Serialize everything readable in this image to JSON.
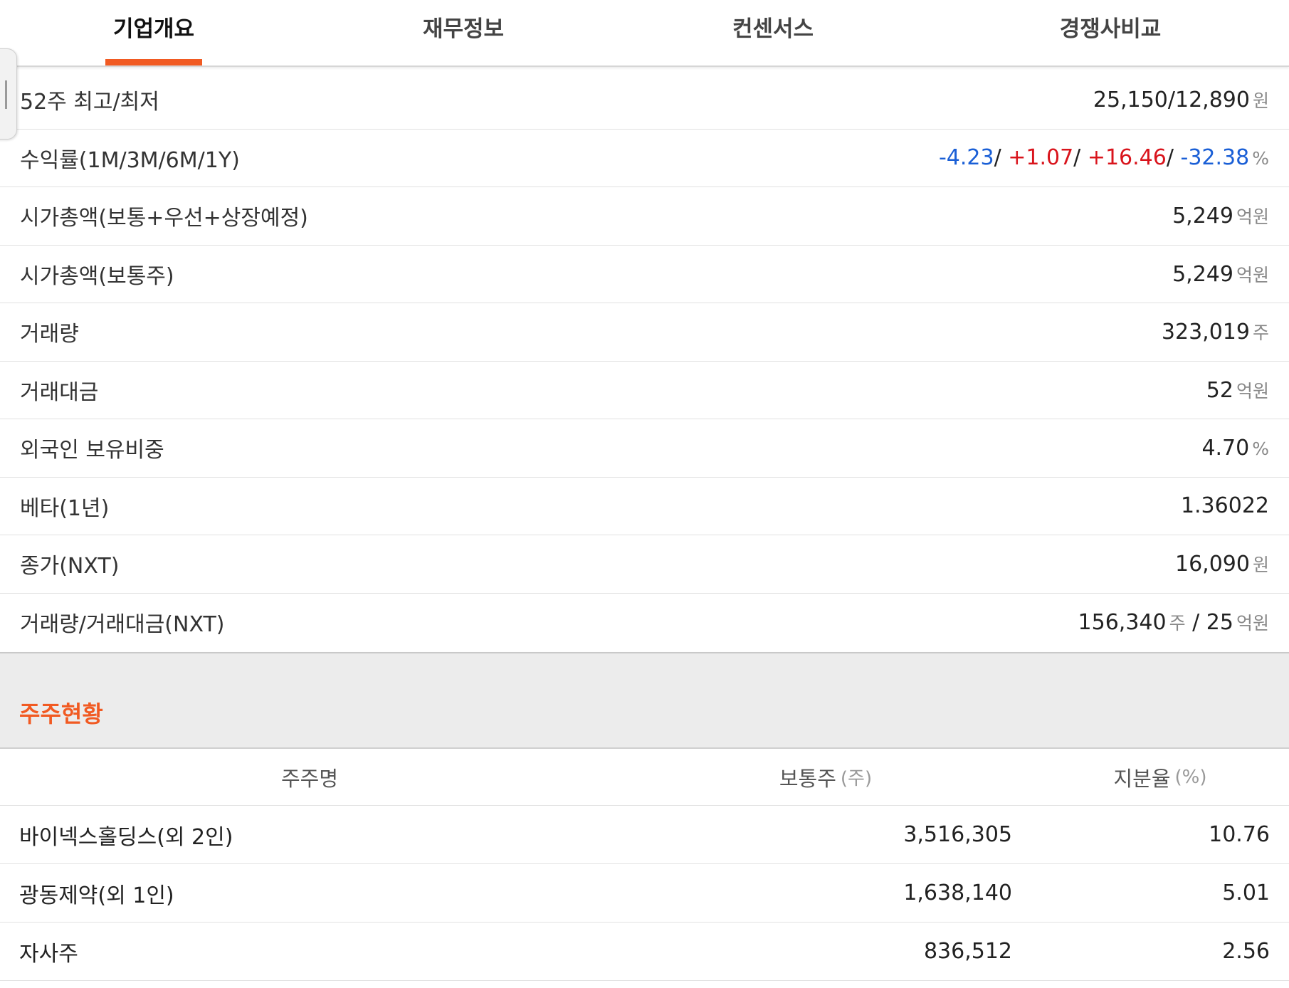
{
  "tabs": [
    {
      "label": "기업개요",
      "active": true
    },
    {
      "label": "재무정보",
      "active": false
    },
    {
      "label": "컨센서스",
      "active": false
    },
    {
      "label": "경쟁사비교",
      "active": false
    }
  ],
  "colors": {
    "accent": "#f15a22",
    "negative": "#1a5fd6",
    "positive": "#d9141c"
  },
  "info": {
    "week52": {
      "label": "52주 최고/최저",
      "value": "25,150/12,890",
      "unit": "원"
    },
    "returns": {
      "label": "수익률(1M/3M/6M/1Y)",
      "r1m": "-4.23",
      "r3m": "+1.07",
      "r6m": "+16.46",
      "r1y": "-32.38",
      "sep": "/ ",
      "unit": "%"
    },
    "mcap_total": {
      "label": "시가총액(보통+우선+상장예정)",
      "value": "5,249",
      "unit": "억원"
    },
    "mcap_common": {
      "label": "시가총액(보통주)",
      "value": "5,249",
      "unit": "억원"
    },
    "volume": {
      "label": "거래량",
      "value": "323,019",
      "unit": "주"
    },
    "trade_value": {
      "label": "거래대금",
      "value": "52",
      "unit": "억원"
    },
    "foreign": {
      "label": "외국인 보유비중",
      "value": "4.70",
      "unit": "%"
    },
    "beta": {
      "label": "베타(1년)",
      "value": "1.36022"
    },
    "close_nxt": {
      "label": "종가(NXT)",
      "value": "16,090",
      "unit": "원"
    },
    "vol_nxt": {
      "label": "거래량/거래대금(NXT)",
      "volume": "156,340",
      "volume_unit": "주",
      "sep": " / ",
      "value": "25",
      "value_unit": "억원"
    }
  },
  "shareholders": {
    "title": "주주현황",
    "headers": {
      "name": "주주명",
      "common": "보통주",
      "common_unit": "(주)",
      "ratio": "지분율",
      "ratio_unit": "(%)"
    },
    "rows": [
      {
        "name": "바이넥스홀딩스(외 2인)",
        "common": "3,516,305",
        "ratio": "10.76"
      },
      {
        "name": "광동제약(외 1인)",
        "common": "1,638,140",
        "ratio": "5.01"
      },
      {
        "name": "자사주",
        "common": "836,512",
        "ratio": "2.56"
      }
    ]
  }
}
